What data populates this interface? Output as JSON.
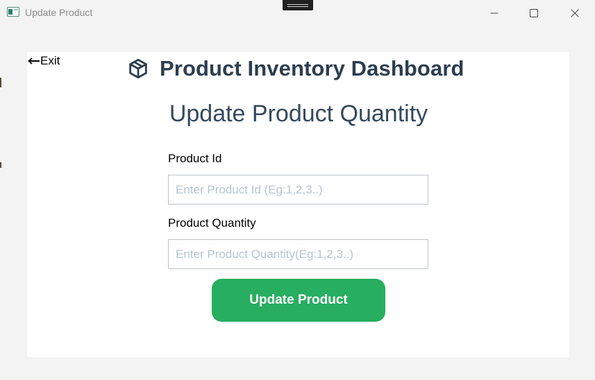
{
  "window": {
    "title": "Update Product",
    "controls": {
      "minimize": "minimize-icon",
      "maximize": "maximize-icon",
      "close": "close-icon"
    }
  },
  "nav": {
    "exit_label": "Exit",
    "exit_icon": "arrow-left-icon"
  },
  "header": {
    "icon": "package-box-icon",
    "title": "Product Inventory Dashboard"
  },
  "form": {
    "heading": "Update Product Quantity",
    "product_id": {
      "label": "Product Id",
      "value": "",
      "placeholder": "Enter Product Id (Eg:1,2,3..)"
    },
    "product_quantity": {
      "label": "Product Quantity",
      "value": "",
      "placeholder": "Enter Product Quantity(Eg:1,2,3..)"
    },
    "submit_label": "Update Product"
  },
  "colors": {
    "heading": "#2c3e50",
    "accent": "#27ae60",
    "input_border": "#bdc3c7",
    "placeholder": "#b8c4cc",
    "window_bg": "#f3f3f3",
    "panel_bg": "#ffffff"
  }
}
